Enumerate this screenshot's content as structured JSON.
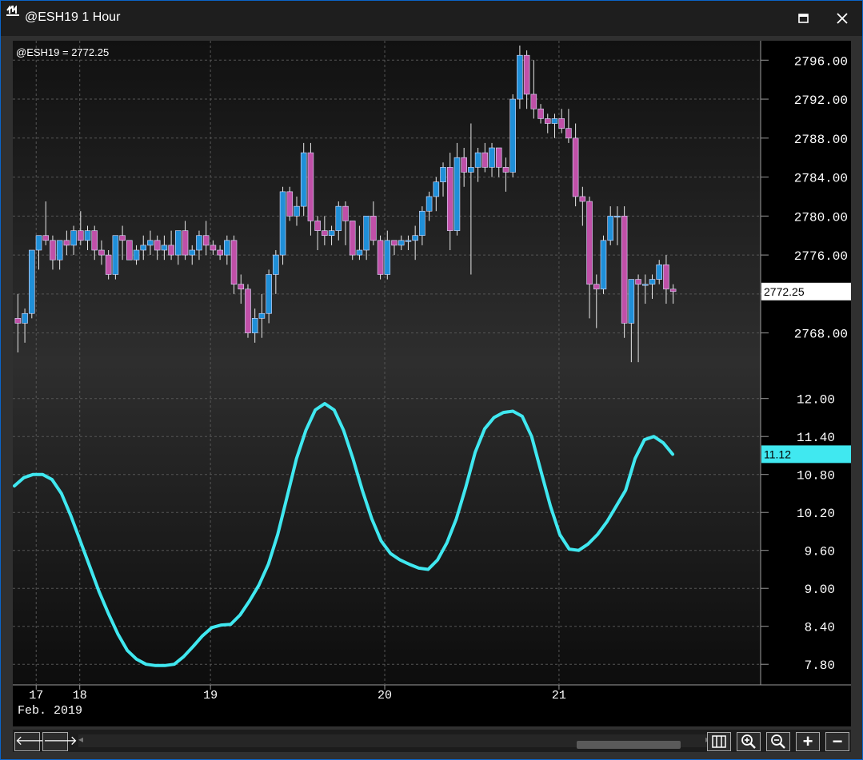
{
  "window": {
    "title": "@ESH19 1 Hour",
    "maximize_icon": "maximize-icon",
    "close_icon": "close-icon"
  },
  "chart_data": [
    {
      "type": "candlestick",
      "symbol_label": "@ESH19 = 2772.25",
      "last_value_label": "2772.25",
      "ylim": [
        2766.0,
        2797.5
      ],
      "y_ticks": [
        "2796.00",
        "2792.00",
        "2788.00",
        "2784.00",
        "2780.00",
        "2776.00",
        "2772.00",
        "2768.00"
      ],
      "x_ticks": [
        {
          "label": "17",
          "x": 0.5
        },
        {
          "label": "18",
          "x": 1.5
        },
        {
          "label": "19",
          "x": 4.5
        },
        {
          "label": "20",
          "x": 8.5
        },
        {
          "label": "21",
          "x": 12.5
        }
      ],
      "x_sublabel": "Feb. 2019",
      "up_color": "#1f8fd8",
      "down_color": "#c050a8",
      "candles": [
        [
          2769.5,
          2772,
          2766,
          2769
        ],
        [
          2769,
          2770.5,
          2767,
          2770
        ],
        [
          2770,
          2776.5,
          2769.5,
          2776.5
        ],
        [
          2776.5,
          2778,
          2774.5,
          2778
        ],
        [
          2778,
          2781.5,
          2777,
          2777.5
        ],
        [
          2777.5,
          2778,
          2774.5,
          2775.5
        ],
        [
          2775.5,
          2777.5,
          2774.5,
          2777.5
        ],
        [
          2777.5,
          2778.5,
          2776,
          2777
        ],
        [
          2777,
          2779,
          2776,
          2778.5
        ],
        [
          2778.5,
          2780.5,
          2777,
          2777.5
        ],
        [
          2777.5,
          2779,
          2776.5,
          2778.5
        ],
        [
          2778.5,
          2779,
          2775.5,
          2776.5
        ],
        [
          2776.5,
          2777.5,
          2775,
          2776
        ],
        [
          2776,
          2776.5,
          2773.5,
          2774
        ],
        [
          2774,
          2778,
          2773.5,
          2778
        ],
        [
          2778,
          2779,
          2775.5,
          2777.5
        ],
        [
          2777.5,
          2777.5,
          2775.5,
          2775.5
        ],
        [
          2775.5,
          2777,
          2775,
          2776.5
        ],
        [
          2776.5,
          2778,
          2775.5,
          2777
        ],
        [
          2777,
          2778.5,
          2776,
          2777.5
        ],
        [
          2777.5,
          2778,
          2775.5,
          2776.5
        ],
        [
          2776.5,
          2778,
          2775.5,
          2777
        ],
        [
          2777,
          2778.5,
          2775.5,
          2776
        ],
        [
          2776,
          2778.5,
          2775,
          2778.5
        ],
        [
          2778.5,
          2779.5,
          2775.5,
          2776
        ],
        [
          2776,
          2777,
          2775,
          2776.5
        ],
        [
          2776.5,
          2778.5,
          2775.5,
          2778
        ],
        [
          2778,
          2779.5,
          2776,
          2777
        ],
        [
          2777,
          2777.5,
          2776,
          2776.5
        ],
        [
          2776.5,
          2777,
          2775.5,
          2776
        ],
        [
          2776,
          2778,
          2775,
          2777.5
        ],
        [
          2777.5,
          2778,
          2772,
          2773
        ],
        [
          2773,
          2774,
          2771,
          2772.5
        ],
        [
          2772.5,
          2773,
          2767.5,
          2768
        ],
        [
          2768,
          2770.5,
          2767,
          2769.5
        ],
        [
          2769.5,
          2772,
          2767.5,
          2770
        ],
        [
          2770,
          2774.5,
          2769,
          2774
        ],
        [
          2774,
          2776.5,
          2772,
          2776
        ],
        [
          2776,
          2783,
          2775,
          2782.5
        ],
        [
          2782.5,
          2783,
          2779.5,
          2780
        ],
        [
          2780,
          2782,
          2779,
          2781
        ],
        [
          2781,
          2787.5,
          2780,
          2786.5
        ],
        [
          2786.5,
          2787.5,
          2778,
          2779.5
        ],
        [
          2779.5,
          2780,
          2776.5,
          2778.5
        ],
        [
          2778.5,
          2780,
          2777,
          2778
        ],
        [
          2778,
          2779,
          2777,
          2778.5
        ],
        [
          2778.5,
          2781.5,
          2777.5,
          2781
        ],
        [
          2781,
          2781.5,
          2777,
          2779.5
        ],
        [
          2779.5,
          2779.5,
          2775.5,
          2776
        ],
        [
          2776,
          2779,
          2775.5,
          2776.5
        ],
        [
          2776.5,
          2780,
          2775.5,
          2780
        ],
        [
          2780,
          2781.5,
          2777,
          2777.5
        ],
        [
          2777.5,
          2778,
          2773.5,
          2774
        ],
        [
          2774,
          2778.5,
          2773.5,
          2777.5
        ],
        [
          2777.5,
          2777.5,
          2776,
          2777
        ],
        [
          2777,
          2778,
          2776.5,
          2777.5
        ],
        [
          2777.5,
          2778,
          2776.5,
          2777.5
        ],
        [
          2777.5,
          2779,
          2775.5,
          2778
        ],
        [
          2778,
          2781,
          2777,
          2780.5
        ],
        [
          2780.5,
          2782.5,
          2779.5,
          2782
        ],
        [
          2782,
          2784,
          2780.5,
          2783.5
        ],
        [
          2783.5,
          2785.5,
          2782,
          2785
        ],
        [
          2785,
          2786.5,
          2776.5,
          2778.5
        ],
        [
          2778.5,
          2787.5,
          2778,
          2786
        ],
        [
          2786,
          2787,
          2783,
          2784.5
        ],
        [
          2784.5,
          2789.5,
          2774,
          2785
        ],
        [
          2785,
          2787,
          2783.5,
          2786.5
        ],
        [
          2786.5,
          2787.5,
          2784.5,
          2785
        ],
        [
          2785,
          2787.5,
          2784,
          2787
        ],
        [
          2787,
          2787,
          2784,
          2785
        ],
        [
          2785,
          2786,
          2782.5,
          2784.5
        ],
        [
          2784.5,
          2792.5,
          2784,
          2792
        ],
        [
          2792,
          2797.5,
          2791,
          2796.5
        ],
        [
          2796.5,
          2797,
          2791,
          2792.5
        ],
        [
          2792.5,
          2796,
          2790,
          2791
        ],
        [
          2791,
          2791.5,
          2789.5,
          2790
        ],
        [
          2790,
          2790.5,
          2788.5,
          2789.5
        ],
        [
          2789.5,
          2790.5,
          2788,
          2790
        ],
        [
          2790,
          2791,
          2788.5,
          2789
        ],
        [
          2789,
          2791,
          2787.5,
          2788
        ],
        [
          2788,
          2789.5,
          2781,
          2782
        ],
        [
          2782,
          2783,
          2779,
          2781.5
        ],
        [
          2781.5,
          2782,
          2769.5,
          2773
        ],
        [
          2773,
          2774,
          2768.5,
          2772.5
        ],
        [
          2772.5,
          2778,
          2772,
          2777.5
        ],
        [
          2777.5,
          2781,
          2777,
          2780
        ],
        [
          2780,
          2781,
          2777,
          2780
        ],
        [
          2780,
          2781,
          2767.5,
          2769
        ],
        [
          2769,
          2773.5,
          2765,
          2773.5
        ],
        [
          2773.5,
          2774,
          2765,
          2773
        ],
        [
          2773,
          2774,
          2771,
          2773
        ],
        [
          2773,
          2774,
          2771.5,
          2773.5
        ],
        [
          2773.5,
          2775.5,
          2773,
          2775
        ],
        [
          2775,
          2776,
          2771,
          2772.5
        ],
        [
          2772.5,
          2773,
          2771,
          2772.25
        ]
      ],
      "x_span": [
        0,
        15.2
      ]
    },
    {
      "type": "line",
      "last_value_label": "11.12",
      "color": "#40e8f0",
      "ylim": [
        7.55,
        12.35
      ],
      "y_ticks": [
        "12.00",
        "11.40",
        "10.80",
        "10.20",
        "9.60",
        "9.00",
        "8.40",
        "7.80"
      ],
      "values": [
        10.62,
        10.75,
        10.8,
        10.8,
        10.72,
        10.5,
        10.15,
        9.75,
        9.35,
        8.95,
        8.6,
        8.28,
        8.02,
        7.88,
        7.8,
        7.78,
        7.78,
        7.8,
        7.92,
        8.08,
        8.25,
        8.38,
        8.42,
        8.43,
        8.58,
        8.8,
        9.05,
        9.38,
        9.85,
        10.45,
        11.05,
        11.5,
        11.82,
        11.92,
        11.82,
        11.5,
        11.05,
        10.55,
        10.1,
        9.75,
        9.55,
        9.45,
        9.38,
        9.32,
        9.3,
        9.45,
        9.72,
        10.1,
        10.6,
        11.15,
        11.52,
        11.7,
        11.78,
        11.8,
        11.72,
        11.4,
        10.85,
        10.3,
        9.85,
        9.62,
        9.6,
        9.7,
        9.85,
        10.05,
        10.3,
        10.55,
        11.05,
        11.35,
        11.4,
        11.3,
        11.12
      ],
      "x_span": [
        0,
        15.2
      ]
    }
  ],
  "toolbar": {
    "back_label": "🡐",
    "forward_label": "🡒",
    "scroll_left_label": "◂",
    "scroll_right_label": "▸",
    "zoom_in_icon": "zoom-in-icon",
    "zoom_out_icon": "zoom-out-icon",
    "plus_label": "+",
    "minus_label": "−"
  }
}
